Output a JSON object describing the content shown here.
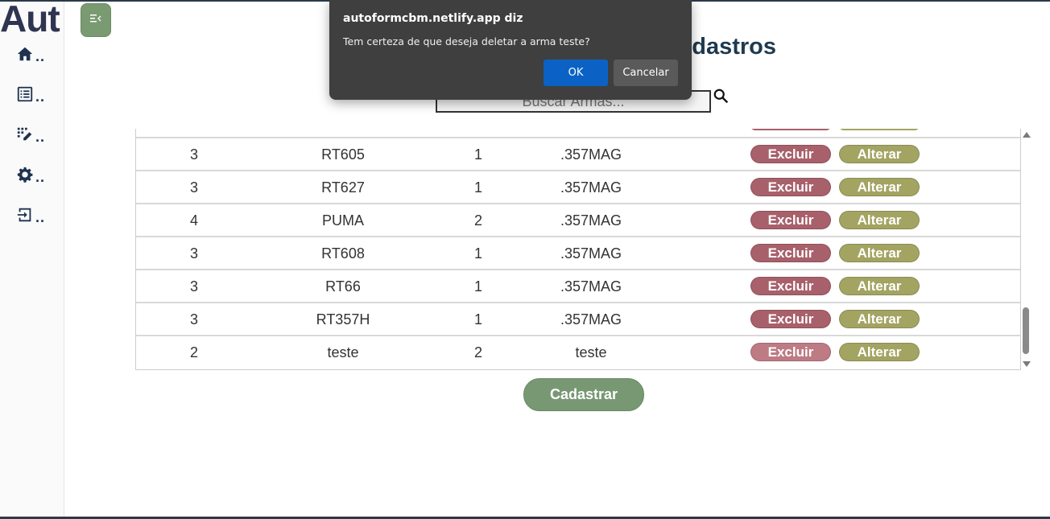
{
  "brand": "Aut",
  "sidebar": {
    "items": [
      {
        "icon": "home-icon",
        "label": ".."
      },
      {
        "icon": "list-icon",
        "label": ".."
      },
      {
        "icon": "edit-list-icon",
        "label": ".."
      },
      {
        "icon": "gear-icon",
        "label": ".."
      },
      {
        "icon": "logout-icon",
        "label": ".."
      }
    ]
  },
  "page": {
    "title": "dastros",
    "search_placeholder": "Buscar Armas..."
  },
  "table": {
    "rows": [
      {
        "c1": "3",
        "c2": "RT605",
        "c3": "1",
        "c4": ".357MAG"
      },
      {
        "c1": "3",
        "c2": "RT627",
        "c3": "1",
        "c4": ".357MAG"
      },
      {
        "c1": "4",
        "c2": "PUMA",
        "c3": "2",
        "c4": ".357MAG"
      },
      {
        "c1": "3",
        "c2": "RT608",
        "c3": "1",
        "c4": ".357MAG"
      },
      {
        "c1": "3",
        "c2": "RT66",
        "c3": "1",
        "c4": ".357MAG"
      },
      {
        "c1": "3",
        "c2": "RT357H",
        "c3": "1",
        "c4": ".357MAG"
      },
      {
        "c1": "2",
        "c2": "teste",
        "c3": "2",
        "c4": "teste"
      }
    ],
    "delete_label": "Excluir",
    "edit_label": "Alterar"
  },
  "register_label": "Cadastrar",
  "dialog": {
    "title": "autoformcbm.netlify.app diz",
    "message": "Tem certeza de que deseja deletar a arma teste?",
    "ok_label": "OK",
    "cancel_label": "Cancelar"
  },
  "colors": {
    "accent_green": "#7a9a72",
    "delete_red": "#a8606a",
    "edit_olive": "#a3a462",
    "dialog_bg": "#3f3f3f",
    "dialog_ok": "#0b62c4"
  }
}
